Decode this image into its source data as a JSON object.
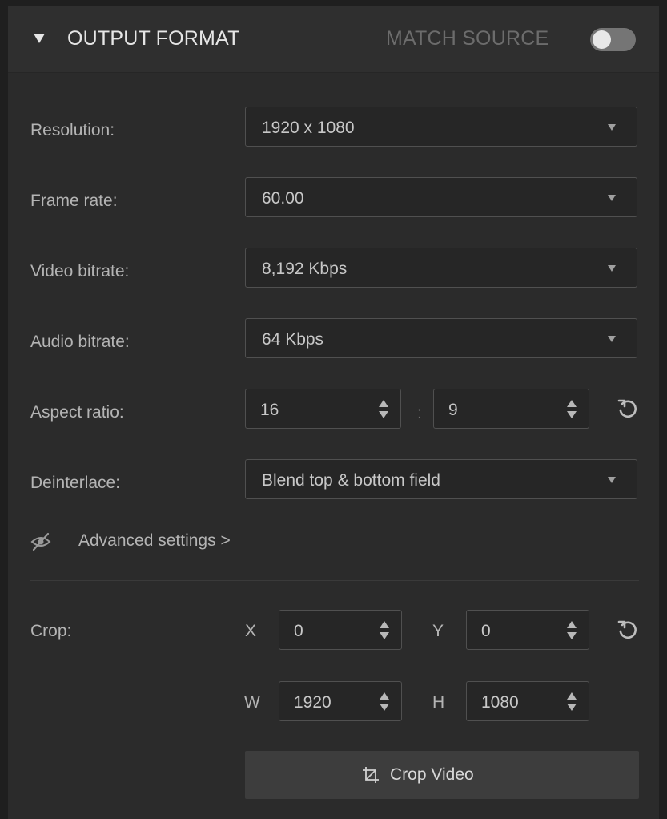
{
  "header": {
    "title": "OUTPUT FORMAT",
    "match_source_label": "MATCH SOURCE",
    "match_source_on": false
  },
  "fields": {
    "resolution": {
      "label": "Resolution:",
      "value": "1920 x 1080"
    },
    "frame_rate": {
      "label": "Frame rate:",
      "value": "60.00"
    },
    "video_bitrate": {
      "label": "Video bitrate:",
      "value": "8,192 Kbps"
    },
    "audio_bitrate": {
      "label": "Audio bitrate:",
      "value": "64 Kbps"
    },
    "aspect_ratio": {
      "label": "Aspect ratio:",
      "width": "16",
      "separator": ":",
      "height": "9"
    },
    "deinterlace": {
      "label": "Deinterlace:",
      "value": "Blend top & bottom field"
    }
  },
  "advanced": {
    "label": "Advanced settings >"
  },
  "crop": {
    "label": "Crop:",
    "x_label": "X",
    "x": "0",
    "y_label": "Y",
    "y": "0",
    "w_label": "W",
    "w": "1920",
    "h_label": "H",
    "h": "1080",
    "button_label": "Crop Video"
  },
  "icons": {
    "collapse": "triangle-down-icon",
    "reset": "reset-icon",
    "advanced": "eye-slash-icon",
    "crop": "crop-icon",
    "select": "caret-down-icon",
    "spinner": "spinner-arrows-icon"
  }
}
